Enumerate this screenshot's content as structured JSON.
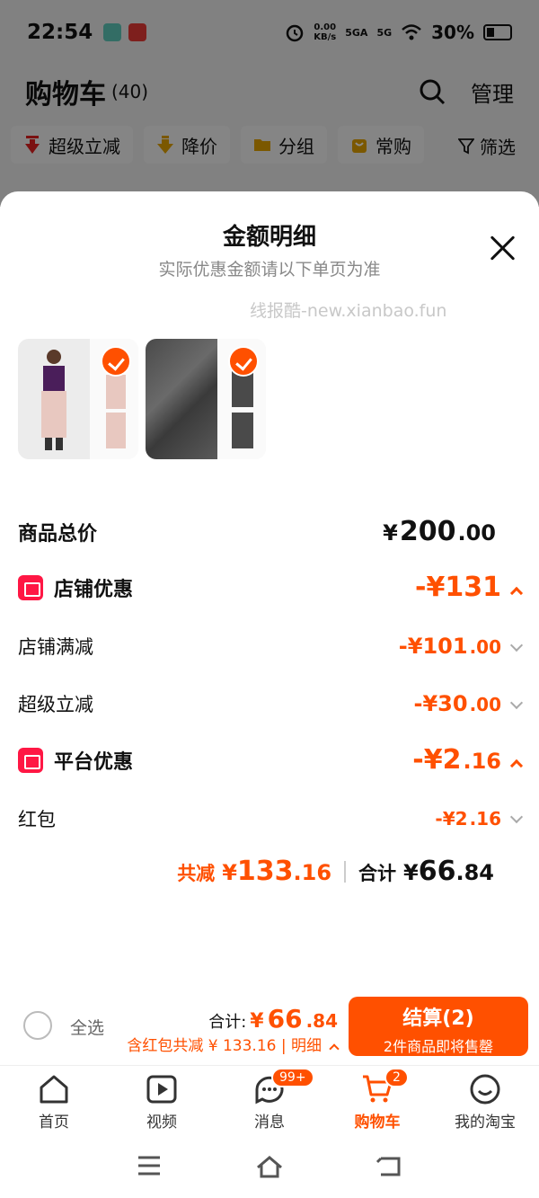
{
  "status_bar": {
    "time": "22:54",
    "net_speed": "0.00",
    "net_unit": "KB/s",
    "sig1": "5GA",
    "sig2": "5G",
    "battery": "30%"
  },
  "cart_header": {
    "title": "购物车",
    "count": "(40)",
    "manage": "管理"
  },
  "filters": [
    {
      "label": "超级立减",
      "icon": "down-arrow-icon",
      "color": "#e02020"
    },
    {
      "label": "降价",
      "icon": "down-arrow-icon",
      "color": "#e0a000"
    },
    {
      "label": "分组",
      "icon": "folder-icon",
      "color": "#e0a000"
    },
    {
      "label": "常购",
      "icon": "bag-icon",
      "color": "#e0a000"
    }
  ],
  "filter_button": "筛选",
  "sheet": {
    "title": "金额明细",
    "subtitle": "实际优惠金额请以下单页为准",
    "watermark": "线报酷-new.xianbao.fun"
  },
  "rows": {
    "total_label": "商品总价",
    "total_currency": "¥",
    "total_int": "200",
    "total_dec": ".00",
    "shop_discount_label": "店铺优惠",
    "shop_discount_amount": "-¥131",
    "shop_full_label": "店铺满减",
    "shop_full_int": "-¥101",
    "shop_full_dec": ".00",
    "super_label": "超级立减",
    "super_int": "-¥30",
    "super_dec": ".00",
    "platform_label": "平台优惠",
    "platform_int": "-¥2",
    "platform_dec": ".16",
    "redpack_label": "红包",
    "redpack_int": "-¥2",
    "redpack_dec": ".16"
  },
  "summary": {
    "saved_label": "共减",
    "saved_currency": "¥",
    "saved_int": "133",
    "saved_dec": ".16",
    "total_label": "合计",
    "total_currency": "¥",
    "total_int": "66",
    "total_dec": ".84"
  },
  "checkout": {
    "select_all": "全选",
    "total_label": "合计:",
    "total_currency": "¥",
    "total_int": "66",
    "total_dec": ".84",
    "note": "含红包共减 ¥ 133.16 | 明细",
    "pay_title": "结算(2)",
    "pay_sub": "2件商品即将售罄"
  },
  "tabbar": [
    {
      "label": "首页",
      "icon": "home-icon"
    },
    {
      "label": "视频",
      "icon": "video-icon"
    },
    {
      "label": "消息",
      "icon": "message-icon",
      "badge": "99+"
    },
    {
      "label": "购物车",
      "icon": "cart-icon",
      "badge": "2",
      "active": true
    },
    {
      "label": "我的淘宝",
      "icon": "profile-icon"
    }
  ],
  "accent_color": "#ff5000"
}
